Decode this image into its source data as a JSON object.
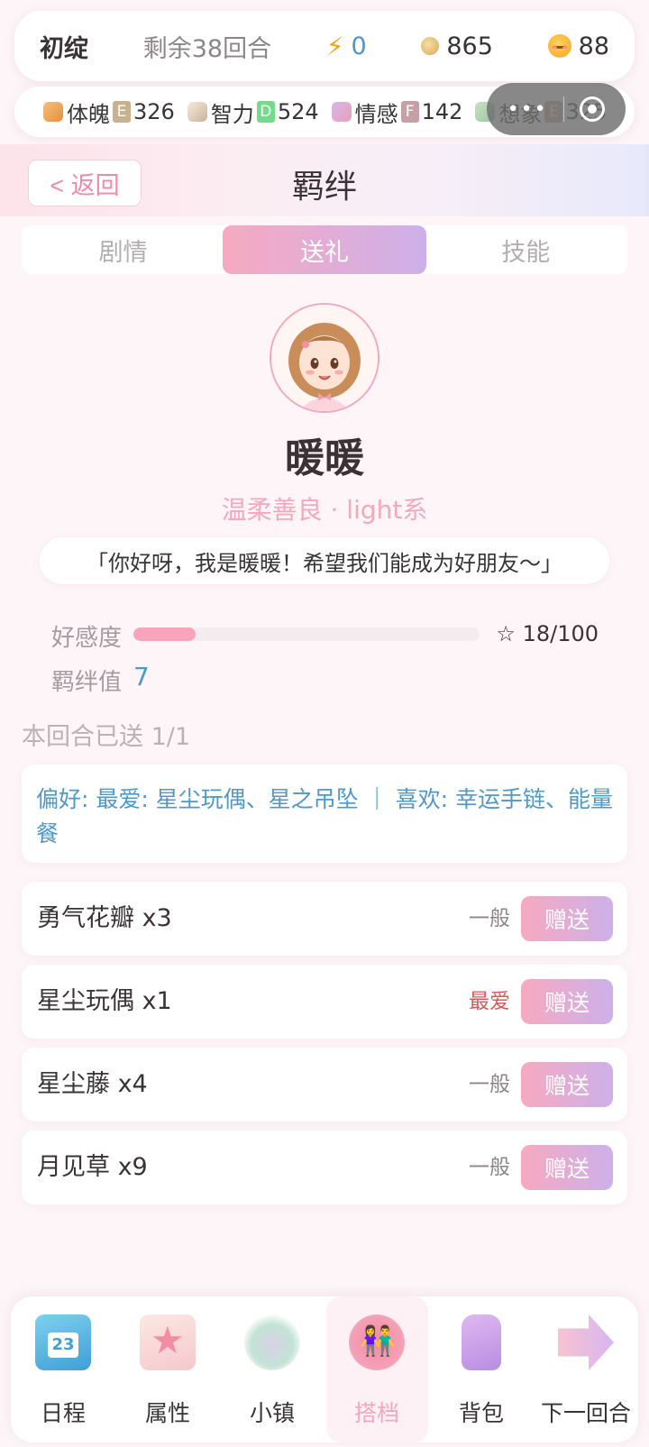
{
  "topbar": {
    "stage": "初绽",
    "rounds_left": "剩余38回合",
    "energy": "0",
    "coins": "865",
    "mood": "88"
  },
  "attributes": [
    {
      "label": "体魄",
      "grade": "E",
      "value": "326",
      "icon": "fist-icon"
    },
    {
      "label": "智力",
      "grade": "D",
      "value": "524",
      "icon": "book-icon"
    },
    {
      "label": "情感",
      "grade": "F",
      "value": "142",
      "icon": "heart-icon"
    },
    {
      "label": "想象",
      "grade": "E",
      "value": "325",
      "icon": "leaf-icon"
    }
  ],
  "header": {
    "back_label": "< 返回",
    "title": "羁绊"
  },
  "tabs": [
    {
      "label": "剧情",
      "active": false
    },
    {
      "label": "送礼",
      "active": true
    },
    {
      "label": "技能",
      "active": false
    }
  ],
  "profile": {
    "name": "暖暖",
    "subtitle": "温柔善良 · light系",
    "quote": "「你好呀，我是暖暖！希望我们能成为好朋友～」"
  },
  "affection": {
    "label": "好感度",
    "value_text": "☆ 18/100",
    "fraction": 0.18
  },
  "bond": {
    "label": "羁绊值",
    "value": "7"
  },
  "sent_info": "本回合已送 1/1",
  "preferences": "偏好: 最爱: 星尘玩偶、星之吊坠 ｜ 喜欢: 幸运手链、能量餐",
  "gifts": [
    {
      "name": "勇气花瓣 x3",
      "pref": "一般",
      "button": "赠送"
    },
    {
      "name": "星尘玩偶 x1",
      "pref": "最爱",
      "button": "赠送"
    },
    {
      "name": "星尘藤 x4",
      "pref": "一般",
      "button": "赠送"
    },
    {
      "name": "月见草 x9",
      "pref": "一般",
      "button": "赠送"
    }
  ],
  "nav": [
    {
      "label": "日程",
      "icon": "calendar-icon"
    },
    {
      "label": "属性",
      "icon": "star-badge-icon"
    },
    {
      "label": "小镇",
      "icon": "town-icon"
    },
    {
      "label": "搭档",
      "icon": "partner-icon",
      "active": true
    },
    {
      "label": "背包",
      "icon": "backpack-icon"
    },
    {
      "label": "下一回合",
      "icon": "next-round-icon"
    }
  ],
  "colors": {
    "accent_pink": "#f7a9c0",
    "accent_purple": "#cdb0ea",
    "info_blue": "#4d99cc",
    "favorite_red": "#d95a5a"
  }
}
